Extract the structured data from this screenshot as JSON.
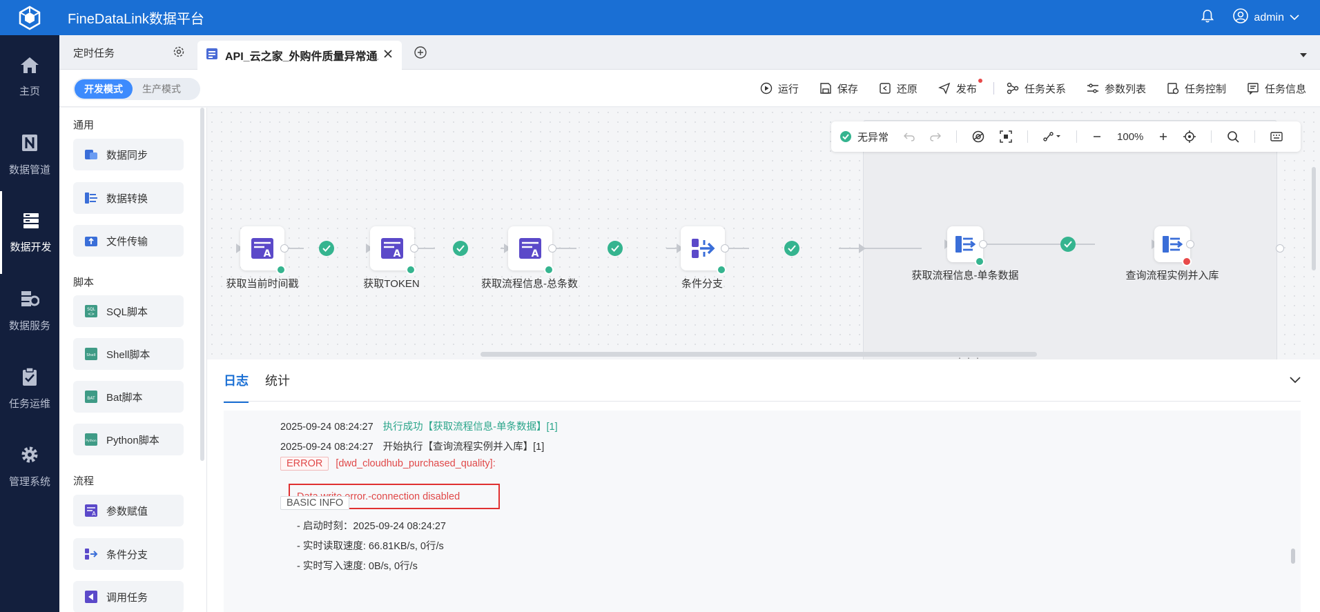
{
  "app": {
    "title": "FineDataLink数据平台",
    "user": "admin"
  },
  "nav": [
    {
      "label": "主页",
      "icon": "home-icon"
    },
    {
      "label": "数据管道",
      "icon": "pipeline-icon"
    },
    {
      "label": "数据开发",
      "icon": "dev-icon",
      "active": true
    },
    {
      "label": "数据服务",
      "icon": "service-icon"
    },
    {
      "label": "任务运维",
      "icon": "ops-icon"
    },
    {
      "label": "管理系统",
      "icon": "gear-icon"
    }
  ],
  "tabs": {
    "scheduled": "定时任务",
    "active_tab": "API_云之家_外购件质量异常通..."
  },
  "toolbar": {
    "mode_dev": "开发模式",
    "mode_prod": "生产模式",
    "run": "运行",
    "save": "保存",
    "restore": "还原",
    "publish": "发布",
    "relations": "任务关系",
    "params": "参数列表",
    "control": "任务控制",
    "info": "任务信息"
  },
  "panel": {
    "section_general": "通用",
    "section_script": "脚本",
    "section_flow": "流程",
    "items": {
      "data_sync": "数据同步",
      "data_transform": "数据转换",
      "file_transfer": "文件传输",
      "sql": "SQL脚本",
      "shell": "Shell脚本",
      "bat": "Bat脚本",
      "python": "Python脚本",
      "param_assign": "参数赋值",
      "condition": "条件分支",
      "call_task": "调用任务"
    }
  },
  "canvas": {
    "status": "无异常",
    "zoom": "100%",
    "nodes": [
      {
        "label": "获取当前时间戳"
      },
      {
        "label": "获取TOKEN"
      },
      {
        "label": "获取流程信息-总条数"
      },
      {
        "label": "条件分支"
      },
      {
        "label": "获取流程信息-单条数据"
      },
      {
        "label": "查询流程实例并入库"
      }
    ]
  },
  "log": {
    "tab_log": "日志",
    "tab_stats": "统计",
    "lines": {
      "l1_ts": "2025-09-24 08:24:27",
      "l1_msg": "执行成功【获取流程信息-单条数据】[1]",
      "l2_ts": "2025-09-24 08:24:27",
      "l2_msg": "开始执行【查询流程实例并入库】[1]",
      "error_tag": "ERROR",
      "error_source": "[dwd_cloudhub_purchased_quality]:",
      "error_msg": "Data write error.-connection disabled",
      "info_tag": "BASIC INFO",
      "start_time": "- 启动时刻：2025-09-24 08:24:27",
      "read_speed": "- 实时读取速度: 66.81KB/s, 0行/s",
      "write_speed": "- 实时写入速度: 0B/s, 0行/s"
    }
  },
  "colors": {
    "primary": "#1a6fd4",
    "nav_bg": "#131f3d",
    "success": "#35b48f",
    "error": "#e84a4a",
    "node_icon": "#5b49c9"
  }
}
